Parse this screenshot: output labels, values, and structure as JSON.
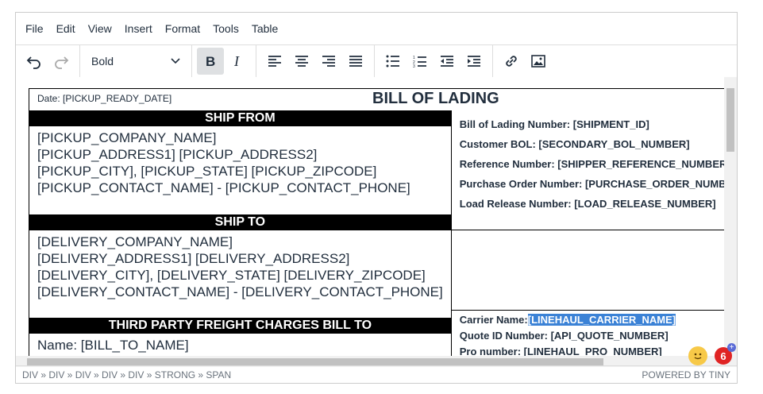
{
  "menubar": [
    "File",
    "Edit",
    "View",
    "Insert",
    "Format",
    "Tools",
    "Table"
  ],
  "toolbar": {
    "format_select": "Bold"
  },
  "document": {
    "date": "Date: [PICKUP_READY_DATE]",
    "title": "BILL OF LADING",
    "ship_from_header": "SHIP FROM",
    "ship_from_lines": [
      "[PICKUP_COMPANY_NAME]",
      "[PICKUP_ADDRESS1] [PICKUP_ADDRESS2]",
      "[PICKUP_CITY], [PICKUP_STATE] [PICKUP_ZIPCODE]",
      "[PICKUP_CONTACT_NAME] - [PICKUP_CONTACT_PHONE]"
    ],
    "ship_to_header": "SHIP TO",
    "ship_to_lines": [
      "[DELIVERY_COMPANY_NAME]",
      "[DELIVERY_ADDRESS1] [DELIVERY_ADDRESS2]",
      "[DELIVERY_CITY], [DELIVERY_STATE] [DELIVERY_ZIPCODE]",
      "[DELIVERY_CONTACT_NAME] - [DELIVERY_CONTACT_PHONE]"
    ],
    "third_party_header": "THIRD PARTY FREIGHT CHARGES BILL TO",
    "bill_to_line": "Name: [BILL_TO_NAME]",
    "ref_lines": [
      "Bill of Lading Number: [SHIPMENT_ID]",
      "Customer BOL: [SECONDARY_BOL_NUMBER]",
      "Reference Number: [SHIPPER_REFERENCE_NUMBER]",
      "Purchase Order Number: [PURCHASE_ORDER_NUMBER]",
      "Load Release Number: [LOAD_RELEASE_NUMBER]"
    ],
    "carrier_label": "Carrier Name:",
    "carrier_value": "[LINEHAUL_CARRIER_NAME]",
    "quote_line": "Quote ID Number: [API_QUOTE_NUMBER]",
    "pro_line": "Pro number: [LINEHAUL_PRO_NUMBER]"
  },
  "statusbar": {
    "path": "DIV » DIV » DIV » DIV » DIV » STRONG » SPAN",
    "powered": "POWERED BY TINY"
  },
  "notification_count": "6",
  "colors": {
    "selection": "#3b82d6",
    "badge": "#e02424"
  }
}
